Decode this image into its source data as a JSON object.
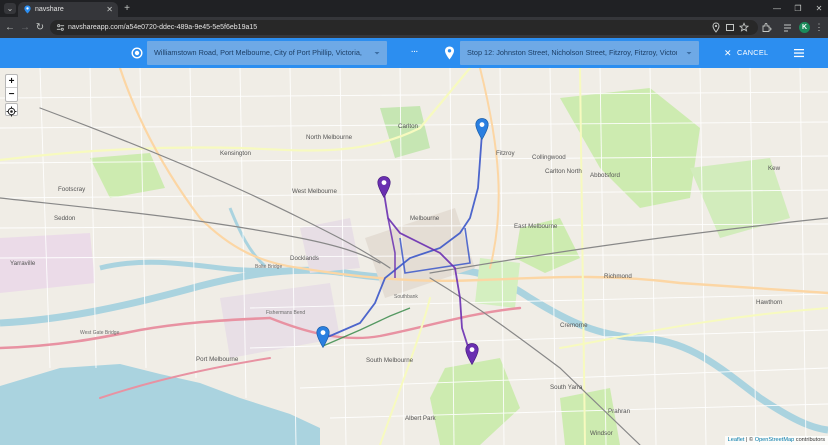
{
  "browser": {
    "tab_title": "navshare",
    "url": "navshareapp.com/a54e0720-ddec-489a-9e45-5e5f6eb19a15",
    "profile_initial": "K",
    "colors": {
      "frame": "#202124",
      "toolbar": "#35363a"
    }
  },
  "app": {
    "origin_value": "Williamstown Road, Port Melbourne, City of Port Phillip, Victoria, ...",
    "destination_value": "Stop 12: Johnston Street, Nicholson Street, Fitzroy, Fitzroy, Victori...",
    "swap_label": "···",
    "cancel_label": "CANCEL",
    "colors": {
      "header": "#2c8ef0",
      "field": "#6ea9e6",
      "route_blue": "#3b57c9",
      "route_purple": "#6a2fb1"
    }
  },
  "map": {
    "zoom_in": "+",
    "zoom_out": "−",
    "attribution": {
      "leaflet": "Leaflet",
      "sep": " | © ",
      "osm": "OpenStreetMap",
      "suffix": " contributors"
    },
    "places": [
      "Carlton North",
      "North Melbourne",
      "West Melbourne",
      "Carlton",
      "Fitzroy",
      "Collingwood",
      "Abbotsford",
      "Kensington",
      "Footscray",
      "Seddon",
      "Docklands",
      "East Melbourne",
      "Melbourne",
      "Richmond",
      "Cremorne",
      "Kew",
      "Hawthorn",
      "South Yarra",
      "Prahran",
      "Windsor",
      "South Melbourne",
      "Port Melbourne",
      "Albert Park",
      "Yarraville",
      "West Gate Bridge",
      "Bolte Bridge",
      "Southbank",
      "Fishermans Bend"
    ]
  }
}
